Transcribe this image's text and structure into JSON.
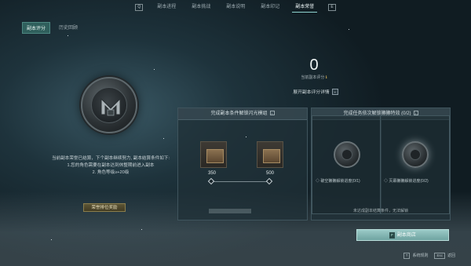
{
  "nav": {
    "left_key": "Q",
    "right_key": "E",
    "tabs": [
      "副本进程",
      "副本挑战",
      "副本说明",
      "副本印记",
      "副本荣誉"
    ],
    "active_index": 4
  },
  "subtabs": [
    "副本评分",
    "历史回顾"
  ],
  "description": [
    "当前副本荣誉已结算，下个副本继续努力, 副本结算条件如下:",
    "1.您的角色需要在副本达到休整期前进入副本",
    "2. 角色等级≥+20级"
  ],
  "reward_button": "荣誉排位奖励",
  "score": {
    "value": "0",
    "label": "当前副本评分"
  },
  "score_detail": "展开副本评分详情",
  "unlock_panel": {
    "title": "完成副本条件解锁闪光模组",
    "milestones": [
      "350",
      "500"
    ]
  },
  "task_panel": {
    "title": "完成任务依次解锁獭獭特效 (0/2)",
    "items": [
      {
        "progress": "破空獭獭解锁进度(0/1)"
      },
      {
        "progress": "灭幕獭獭解锁进度(0/2)"
      }
    ],
    "note": "未达成副本结算条件，无法解锁"
  },
  "shop": {
    "key": "F",
    "label": "副本商店"
  },
  "footer": {
    "rules_key": "T",
    "rules": "系统规则",
    "close_key": "Esc",
    "close": "返回"
  }
}
